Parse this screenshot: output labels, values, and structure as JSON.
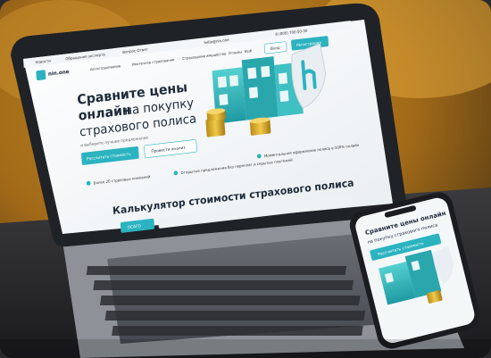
{
  "site": {
    "logo_text": "nin.one",
    "topbar": {
      "links": [
        "Новости",
        "Обращение эксперта",
        "Вопрос-Ответ"
      ],
      "email": "hello@nin.one",
      "phone": "8 (800) 700-50-30"
    },
    "nav": {
      "items": [
        "Автострахование",
        "Ипотечное страхование",
        "Страхование имущества",
        "Отзывы",
        "Ещё"
      ],
      "login_label": "Вход",
      "register_label": "Регистрация"
    },
    "hero": {
      "title_bold_1": "Сравните цены",
      "title_bold_2": "онлайн",
      "title_rest_1": "на покупку",
      "title_rest_2": "страхового полиса",
      "subtitle": "и выберите лучшее предложение",
      "primary_button": "Рассчитать стоимость",
      "secondary_button": "Провести анализ"
    },
    "features": [
      "Более 20 страховых компаний",
      "Открытые предложения без переплат и скрытых платежей",
      "Моментальное оформление полиса в 100% онлайн"
    ],
    "calculator": {
      "title": "Калькулятор стоимости страхового полиса",
      "tab_active": "ОСАГО"
    },
    "colors": {
      "accent": "#2bb3c0",
      "dark": "#1e2a3a"
    }
  },
  "phone_screen": {
    "title_bold": "Сравните цены онлайн",
    "title_rest": "на покупку страхового полиса",
    "button": "Рассчитать стоимость"
  }
}
